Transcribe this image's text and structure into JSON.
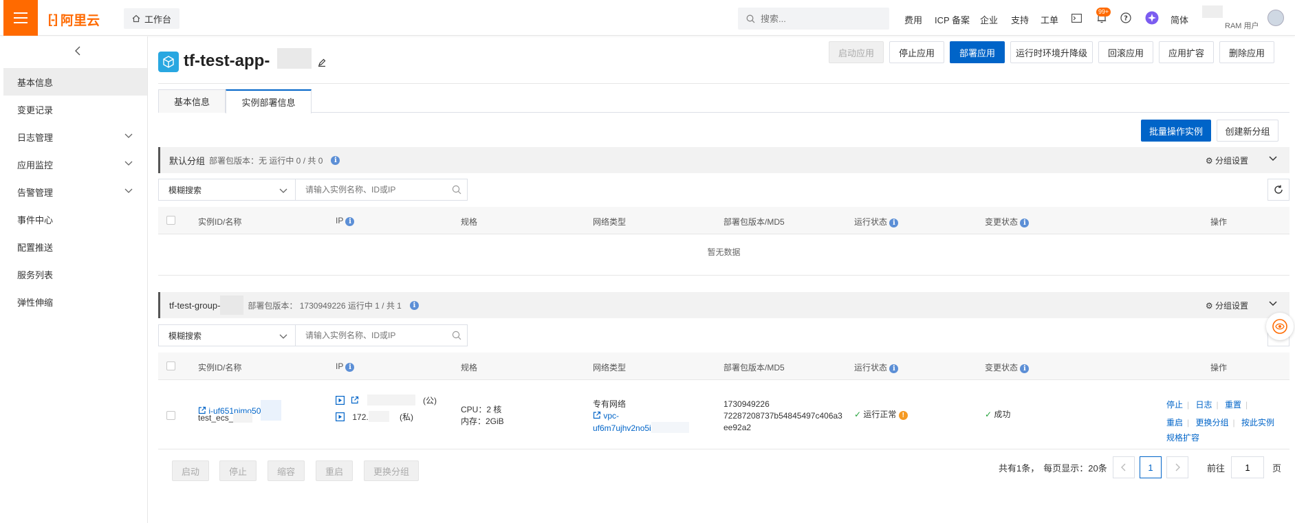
{
  "topbar": {
    "logo_text": "阿里云",
    "logo_mark": "[-]",
    "workbench_label": "工作台",
    "search_placeholder": "搜索...",
    "nav": [
      "费用",
      "ICP 备案",
      "企业",
      "支持",
      "工单"
    ],
    "notification_count": "99+",
    "language": "简体",
    "user_role": "RAM 用户"
  },
  "sidebar": {
    "items": [
      {
        "label": "基本信息",
        "active": true,
        "expandable": false
      },
      {
        "label": "变更记录",
        "active": false,
        "expandable": false
      },
      {
        "label": "日志管理",
        "active": false,
        "expandable": true
      },
      {
        "label": "应用监控",
        "active": false,
        "expandable": true
      },
      {
        "label": "告警管理",
        "active": false,
        "expandable": true
      },
      {
        "label": "事件中心",
        "active": false,
        "expandable": false
      },
      {
        "label": "配置推送",
        "active": false,
        "expandable": false
      },
      {
        "label": "服务列表",
        "active": false,
        "expandable": false
      },
      {
        "label": "弹性伸缩",
        "active": false,
        "expandable": false
      }
    ]
  },
  "header": {
    "app_name": "tf-test-app-",
    "actions": [
      "启动应用",
      "停止应用",
      "部署应用",
      "运行时环境升降级",
      "回滚应用",
      "应用扩容",
      "删除应用"
    ]
  },
  "tabs": [
    "基本信息",
    "实例部署信息"
  ],
  "toolbar": {
    "batch_label": "批量操作实例",
    "create_group_label": "创建新分组"
  },
  "filter": {
    "mode_label": "模糊搜索",
    "placeholder": "请输入实例名称、ID或IP"
  },
  "columns": [
    "实例ID/名称",
    "IP",
    "规格",
    "网络类型",
    "部署包版本/MD5",
    "运行状态",
    "变更状态",
    "操作"
  ],
  "groups": [
    {
      "name": "默认分组",
      "meta": "部署包版本：无   运行中 0 / 共 0",
      "settings_label": "分组设置",
      "empty_text": "暂无数据"
    },
    {
      "name": "tf-test-group-",
      "meta": "部署包版本： 1730949226   运行中 1 / 共 1",
      "settings_label": "分组设置"
    }
  ],
  "instance": {
    "id": "i-uf651njmo50",
    "name": "test_ecs_",
    "ip_public_suffix": "(公)",
    "ip_private": "172.",
    "ip_private_suffix": "(私)",
    "cpu": "CPU：2 核",
    "memory": "内存：2GiB",
    "network_type": "专有网络",
    "vpc_line1": "vpc-",
    "vpc_line2": "uf6m7ujhv2no5i",
    "version": "1730949226",
    "md5_line1": "72287208737b54845497c406a3",
    "md5_line2": "ee92a2",
    "run_status": "运行正常",
    "change_status": "成功",
    "ops": [
      "停止",
      "日志",
      "重置",
      "重启",
      "更换分组",
      "按此实例",
      "规格扩容"
    ]
  },
  "bulk_actions": [
    "启动",
    "停止",
    "缩容",
    "重启",
    "更换分组"
  ],
  "pagination": {
    "summary": "共有1条，",
    "page_size_label": "每页显示：20条",
    "current_page": "1",
    "goto_label": "前往",
    "goto_value": "1",
    "page_suffix": "页"
  },
  "colors": {
    "primary": "#0064c8",
    "brand": "#ff6a00",
    "success": "#23a23a",
    "warning": "#f59a23"
  }
}
